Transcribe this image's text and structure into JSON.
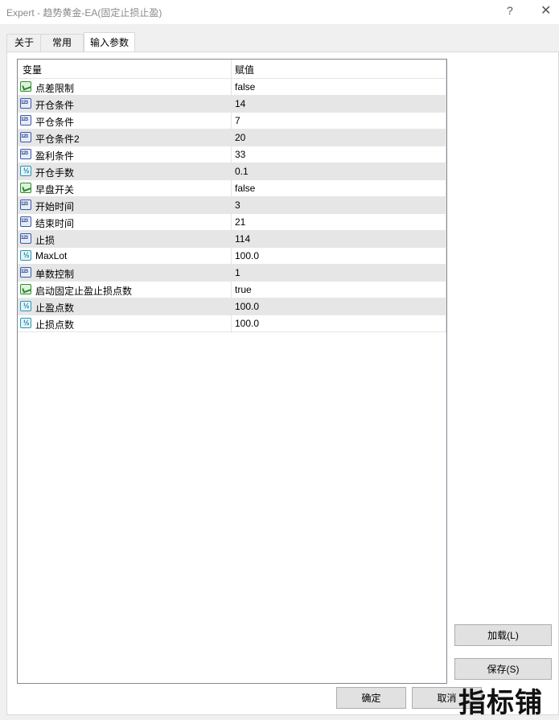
{
  "window": {
    "title": "Expert - 趋势黄金-EA(固定止损止盈)",
    "help_glyph": "?",
    "close_glyph": "✕"
  },
  "tabs": [
    {
      "label": "关于"
    },
    {
      "label": "常用"
    },
    {
      "label": "输入参数",
      "active": true
    }
  ],
  "grid": {
    "columns": {
      "variable": "变量",
      "value": "赋值"
    },
    "rows": [
      {
        "name": "点差限制",
        "value": "false",
        "type_icon": "bool-icon"
      },
      {
        "name": "开仓条件",
        "value": "14",
        "type_icon": "int-icon"
      },
      {
        "name": "平仓条件",
        "value": "7",
        "type_icon": "int-icon"
      },
      {
        "name": "平仓条件2",
        "value": "20",
        "type_icon": "int-icon"
      },
      {
        "name": "盈利条件",
        "value": "33",
        "type_icon": "int-icon"
      },
      {
        "name": "开仓手数",
        "value": "0.1",
        "type_icon": "double-icon"
      },
      {
        "name": "早盘开关",
        "value": "false",
        "type_icon": "bool-icon"
      },
      {
        "name": "开始时间",
        "value": "3",
        "type_icon": "int-icon"
      },
      {
        "name": "结束时间",
        "value": "21",
        "type_icon": "int-icon"
      },
      {
        "name": "止损",
        "value": "114",
        "type_icon": "int-icon"
      },
      {
        "name": "MaxLot",
        "value": "100.0",
        "type_icon": "double-icon"
      },
      {
        "name": "单数控制",
        "value": "1",
        "type_icon": "int-icon"
      },
      {
        "name": "启动固定止盈止损点数",
        "value": "true",
        "type_icon": "bool-icon"
      },
      {
        "name": "止盈点数",
        "value": "100.0",
        "type_icon": "double-icon"
      },
      {
        "name": "止损点数",
        "value": "100.0",
        "type_icon": "double-icon"
      }
    ]
  },
  "buttons": {
    "load": "加载(L)",
    "save": "保存(S)",
    "ok": "确定",
    "cancel": "取消"
  },
  "watermark": "指标铺"
}
